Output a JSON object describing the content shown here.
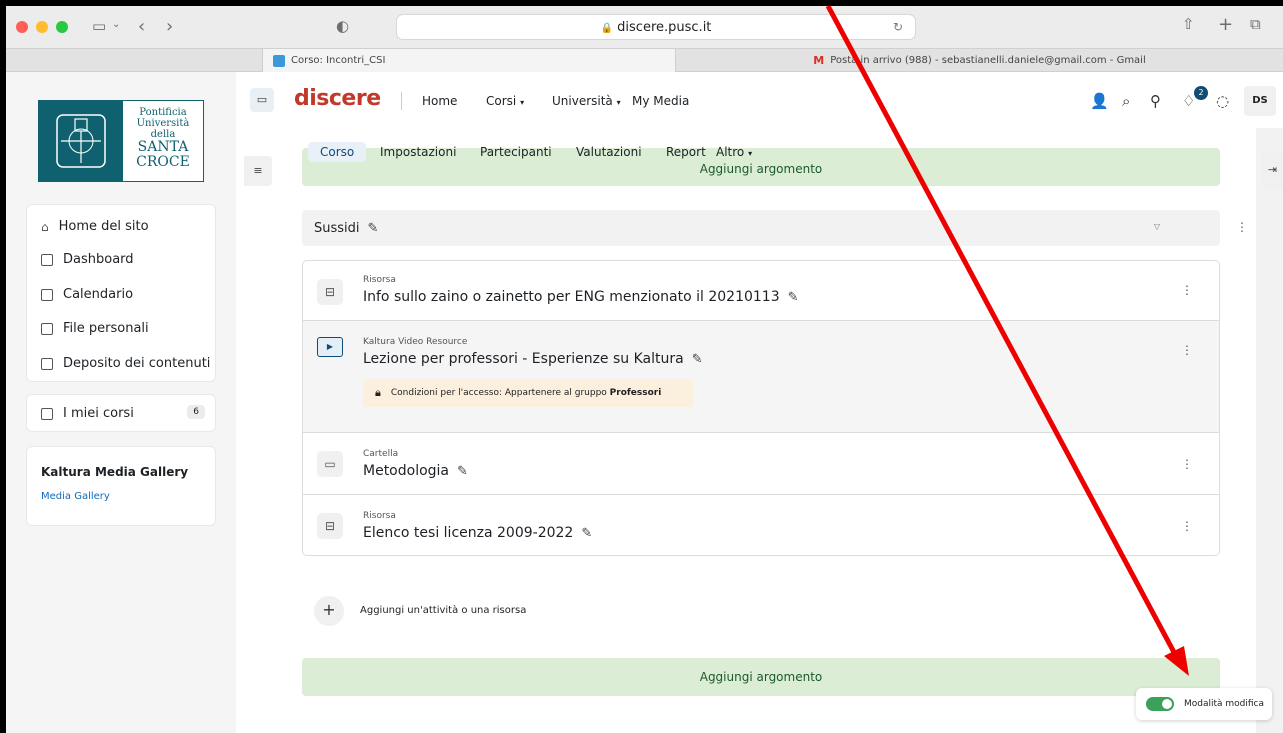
{
  "browser": {
    "url": "discere.pusc.it",
    "tabs": [
      {
        "label": "Corso: Incontri_CSI"
      },
      {
        "label": "Posta in arrivo (988) - sebastianelli.daniele@gmail.com - Gmail"
      }
    ]
  },
  "logo": {
    "line1": "Pontificia",
    "line2": "Università",
    "line3": "della",
    "line4": "SANTA",
    "line5": "CROCE"
  },
  "sidebar": {
    "items": [
      {
        "label": "Home del sito"
      },
      {
        "label": "Dashboard"
      },
      {
        "label": "Calendario"
      },
      {
        "label": "File personali"
      },
      {
        "label": "Deposito dei contenuti"
      }
    ],
    "my_courses": {
      "label": "I miei corsi",
      "count": "6"
    },
    "kaltura": {
      "title": "Kaltura Media Gallery",
      "link": "Media Gallery"
    }
  },
  "topnav": {
    "brand": "discere",
    "links": [
      "Home",
      "Corsi",
      "Università",
      "My Media"
    ],
    "notifications_count": "2",
    "user_initials": "DS"
  },
  "course_tabs": [
    "Corso",
    "Impostazioni",
    "Partecipanti",
    "Valutazioni",
    "Report",
    "Altro"
  ],
  "add_topic_label": "Aggiungi argomento",
  "section": {
    "name": "Sussidi",
    "items": [
      {
        "type": "Risorsa",
        "title": "Info sullo zaino o zainetto per ENG menzionato il 20210113"
      },
      {
        "type": "Kaltura Video Resource",
        "title": "Lezione per professori - Esperienze su Kaltura",
        "restriction_prefix": "Condizioni per l'accesso: Appartenere al gruppo ",
        "restriction_group": "Professori"
      },
      {
        "type": "Cartella",
        "title": "Metodologia"
      },
      {
        "type": "Risorsa",
        "title": "Elenco tesi licenza 2009-2022"
      }
    ]
  },
  "add_activity_label": "Aggiungi un'attività o una risorsa",
  "edit_mode_label": "Modalità modifica",
  "colors": {
    "accent_green": "#dcedd6",
    "toggle_green": "#3ba05a",
    "brand_teal": "#10616f",
    "annotation_arrow": "#ee0000"
  }
}
